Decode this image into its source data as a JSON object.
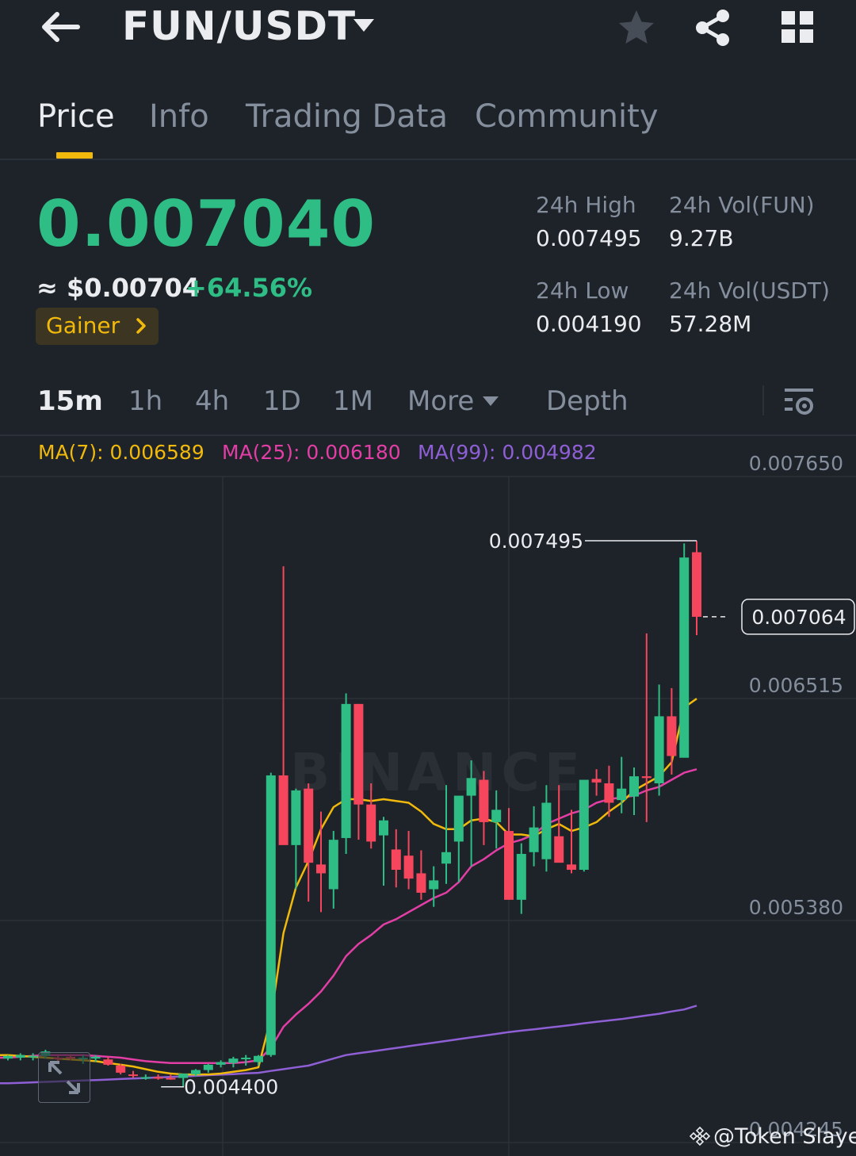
{
  "header": {
    "pair": "FUN/USDT",
    "icons": [
      "back-arrow-icon",
      "caret-down-icon",
      "star-icon",
      "share-icon",
      "grid-icon"
    ]
  },
  "tabs": [
    {
      "label": "Price",
      "active": true
    },
    {
      "label": "Info",
      "active": false
    },
    {
      "label": "Trading Data",
      "active": false
    },
    {
      "label": "Community",
      "active": false
    }
  ],
  "price": {
    "last": "0.007040",
    "approx_usd": "≈ $0.00704",
    "change": "+64.56%",
    "badge": "Gainer"
  },
  "stats": {
    "high_label": "24h High",
    "high_value": "0.007495",
    "vol_base_label": "24h Vol(FUN)",
    "vol_base_value": "9.27B",
    "low_label": "24h Low",
    "low_value": "0.004190",
    "vol_quote_label": "24h Vol(USDT)",
    "vol_quote_value": "57.28M"
  },
  "intervals": {
    "items": [
      "15m",
      "1h",
      "4h",
      "1D",
      "1M"
    ],
    "active": "15m",
    "more": "More",
    "depth": "Depth"
  },
  "chart": {
    "ma7": "MA(7): 0.006589",
    "ma25": "MA(25): 0.006180",
    "ma99": "MA(99): 0.004982",
    "y_ticks": [
      "0.007650",
      "0.006515",
      "0.005380",
      "0.004245"
    ],
    "high_marker": "0.007495",
    "low_marker": "0.004400",
    "current_price": "0.007064",
    "watermark": "BINANCE",
    "colors": {
      "up": "#2ebd85",
      "down": "#f6465d",
      "ma7": "#f0b90b",
      "ma25": "#e33ea5",
      "ma99": "#8f5fd6"
    }
  },
  "chart_data": {
    "type": "candlestick",
    "interval": "15m",
    "y_ticks": [
      0.00765,
      0.006515,
      0.00538,
      0.004245
    ],
    "ylim": [
      0.004165,
      0.00794
    ],
    "candles": [
      {
        "o": 0.00456,
        "h": 0.00458,
        "l": 0.00455,
        "c": 0.004575
      },
      {
        "o": 0.004565,
        "h": 0.00459,
        "l": 0.00455,
        "c": 0.00458
      },
      {
        "o": 0.00457,
        "h": 0.00459,
        "l": 0.00455,
        "c": 0.004575
      },
      {
        "o": 0.004575,
        "h": 0.00461,
        "l": 0.00456,
        "c": 0.0046
      },
      {
        "o": 0.004565,
        "h": 0.00458,
        "l": 0.00454,
        "c": 0.00456
      },
      {
        "o": 0.00457,
        "h": 0.004585,
        "l": 0.00455,
        "c": 0.00456
      },
      {
        "o": 0.00456,
        "h": 0.00458,
        "l": 0.00453,
        "c": 0.004565
      },
      {
        "o": 0.00456,
        "h": 0.00458,
        "l": 0.00454,
        "c": 0.00457
      },
      {
        "o": 0.004555,
        "h": 0.00457,
        "l": 0.00452,
        "c": 0.004525
      },
      {
        "o": 0.00452,
        "h": 0.00453,
        "l": 0.00447,
        "c": 0.00448
      },
      {
        "o": 0.00447,
        "h": 0.00449,
        "l": 0.00445,
        "c": 0.004465
      },
      {
        "o": 0.004455,
        "h": 0.00447,
        "l": 0.00444,
        "c": 0.004455
      },
      {
        "o": 0.004455,
        "h": 0.00447,
        "l": 0.00444,
        "c": 0.00445
      },
      {
        "o": 0.00445,
        "h": 0.00447,
        "l": 0.00444,
        "c": 0.004445
      },
      {
        "o": 0.00445,
        "h": 0.004475,
        "l": 0.0044,
        "c": 0.004475
      },
      {
        "o": 0.00447,
        "h": 0.0045,
        "l": 0.00446,
        "c": 0.004495
      },
      {
        "o": 0.004495,
        "h": 0.00453,
        "l": 0.00448,
        "c": 0.004525
      },
      {
        "o": 0.004525,
        "h": 0.00455,
        "l": 0.00451,
        "c": 0.00454
      },
      {
        "o": 0.004535,
        "h": 0.00457,
        "l": 0.00451,
        "c": 0.00456
      },
      {
        "o": 0.00456,
        "h": 0.00458,
        "l": 0.00452,
        "c": 0.004565
      },
      {
        "o": 0.00454,
        "h": 0.00458,
        "l": 0.00452,
        "c": 0.004575
      },
      {
        "o": 0.00458,
        "h": 0.00618,
        "l": 0.00457,
        "c": 0.006165
      },
      {
        "o": 0.006165,
        "h": 0.00735,
        "l": 0.00578,
        "c": 0.00577
      },
      {
        "o": 0.00577,
        "h": 0.00609,
        "l": 0.00552,
        "c": 0.00608
      },
      {
        "o": 0.00609,
        "h": 0.00612,
        "l": 0.00545,
        "c": 0.00567
      },
      {
        "o": 0.00566,
        "h": 0.00596,
        "l": 0.00539,
        "c": 0.00561
      },
      {
        "o": 0.00552,
        "h": 0.00585,
        "l": 0.00541,
        "c": 0.0058
      },
      {
        "o": 0.00581,
        "h": 0.00663,
        "l": 0.00572,
        "c": 0.00657
      },
      {
        "o": 0.00657,
        "h": 0.00657,
        "l": 0.0058,
        "c": 0.006
      },
      {
        "o": 0.006,
        "h": 0.00612,
        "l": 0.00575,
        "c": 0.00579
      },
      {
        "o": 0.005825,
        "h": 0.00593,
        "l": 0.00554,
        "c": 0.00591
      },
      {
        "o": 0.005745,
        "h": 0.00586,
        "l": 0.00553,
        "c": 0.00563
      },
      {
        "o": 0.00571,
        "h": 0.00585,
        "l": 0.00552,
        "c": 0.00558
      },
      {
        "o": 0.00561,
        "h": 0.00574,
        "l": 0.00546,
        "c": 0.0055
      },
      {
        "o": 0.00552,
        "h": 0.00565,
        "l": 0.00542,
        "c": 0.00557
      },
      {
        "o": 0.005665,
        "h": 0.00611,
        "l": 0.00555,
        "c": 0.00573
      },
      {
        "o": 0.00579,
        "h": 0.00605,
        "l": 0.00556,
        "c": 0.00605
      },
      {
        "o": 0.00605,
        "h": 0.00625,
        "l": 0.00565,
        "c": 0.00615
      },
      {
        "o": 0.00614,
        "h": 0.00619,
        "l": 0.00577,
        "c": 0.0059
      },
      {
        "o": 0.0059,
        "h": 0.00608,
        "l": 0.00575,
        "c": 0.00597
      },
      {
        "o": 0.00585,
        "h": 0.00598,
        "l": 0.00547,
        "c": 0.00546
      },
      {
        "o": 0.00546,
        "h": 0.00578,
        "l": 0.00538,
        "c": 0.00572
      },
      {
        "o": 0.00573,
        "h": 0.00599,
        "l": 0.00565,
        "c": 0.00587
      },
      {
        "o": 0.00569,
        "h": 0.00611,
        "l": 0.00562,
        "c": 0.00601
      },
      {
        "o": 0.00582,
        "h": 0.00611,
        "l": 0.00568,
        "c": 0.00567
      },
      {
        "o": 0.00566,
        "h": 0.00597,
        "l": 0.00561,
        "c": 0.00563
      },
      {
        "o": 0.00563,
        "h": 0.00612,
        "l": 0.00562,
        "c": 0.00614
      },
      {
        "o": 0.006145,
        "h": 0.0062,
        "l": 0.00605,
        "c": 0.006125
      },
      {
        "o": 0.00612,
        "h": 0.00622,
        "l": 0.00593,
        "c": 0.00601
      },
      {
        "o": 0.006025,
        "h": 0.00627,
        "l": 0.00595,
        "c": 0.00609
      },
      {
        "o": 0.006045,
        "h": 0.00621,
        "l": 0.00594,
        "c": 0.00616
      },
      {
        "o": 0.00616,
        "h": 0.00697,
        "l": 0.0059,
        "c": 0.00615
      },
      {
        "o": 0.00612,
        "h": 0.00668,
        "l": 0.00605,
        "c": 0.0065
      },
      {
        "o": 0.0065,
        "h": 0.00666,
        "l": 0.00617,
        "c": 0.006275
      },
      {
        "o": 0.006265,
        "h": 0.00748,
        "l": 0.00645,
        "c": 0.0074
      },
      {
        "o": 0.00743,
        "h": 0.007495,
        "l": 0.00696,
        "c": 0.007064
      }
    ],
    "ma7": [
      0.00458,
      0.004575,
      0.00457,
      0.004565,
      0.00456,
      0.004555,
      0.00455,
      0.004545,
      0.004535,
      0.004525,
      0.004515,
      0.0045,
      0.004485,
      0.004475,
      0.00447,
      0.00447,
      0.00447,
      0.004475,
      0.004485,
      0.004495,
      0.00451,
      0.00479,
      0.00527,
      0.00553,
      0.00568,
      0.00586,
      0.005985,
      0.00603,
      0.00603,
      0.00602,
      0.00603,
      0.00602,
      0.00601,
      0.00596,
      0.00589,
      0.00586,
      0.00586,
      0.00591,
      0.00592,
      0.0059,
      0.00583,
      0.00583,
      0.00582,
      0.00586,
      0.00589,
      0.00585,
      0.00587,
      0.0059,
      0.00596,
      0.00601,
      0.00608,
      0.00612,
      0.00616,
      0.00624,
      0.00655,
      0.0066
    ],
    "ma25": [
      0.004565,
      0.00457,
      0.004575,
      0.00458,
      0.00458,
      0.00458,
      0.00458,
      0.004575,
      0.00457,
      0.004565,
      0.004555,
      0.004545,
      0.00454,
      0.004535,
      0.004535,
      0.004535,
      0.004535,
      0.004535,
      0.004535,
      0.00454,
      0.00455,
      0.00462,
      0.00474,
      0.00481,
      0.00487,
      0.00494,
      0.00503,
      0.00514,
      0.00521,
      0.00526,
      0.00532,
      0.00535,
      0.00539,
      0.00543,
      0.00547,
      0.0055,
      0.00556,
      0.00565,
      0.00569,
      0.00574,
      0.00578,
      0.0058,
      0.00583,
      0.00589,
      0.00592,
      0.00595,
      0.00597,
      0.00601,
      0.00603,
      0.00604,
      0.00605,
      0.00608,
      0.0061,
      0.00614,
      0.00618,
      0.0062
    ],
    "ma99": [
      0.00442,
      0.004422,
      0.004425,
      0.004428,
      0.00443,
      0.004433,
      0.004436,
      0.004438,
      0.004441,
      0.004444,
      0.004447,
      0.00445,
      0.004453,
      0.004456,
      0.004459,
      0.004462,
      0.004466,
      0.004469,
      0.004472,
      0.004476,
      0.004479,
      0.00449,
      0.0045,
      0.00451,
      0.00452,
      0.00454,
      0.00456,
      0.00458,
      0.00459,
      0.0046,
      0.00461,
      0.00462,
      0.00463,
      0.00464,
      0.00465,
      0.00466,
      0.00467,
      0.00468,
      0.00469,
      0.0047,
      0.00471,
      0.004718,
      0.004726,
      0.004734,
      0.004742,
      0.00475,
      0.00476,
      0.004768,
      0.004776,
      0.004784,
      0.004794,
      0.004804,
      0.004814,
      0.004827,
      0.004838,
      0.00486
    ],
    "high": 0.007495,
    "low": 0.0044,
    "current": 0.007064
  },
  "credit": "@Token Slayer"
}
